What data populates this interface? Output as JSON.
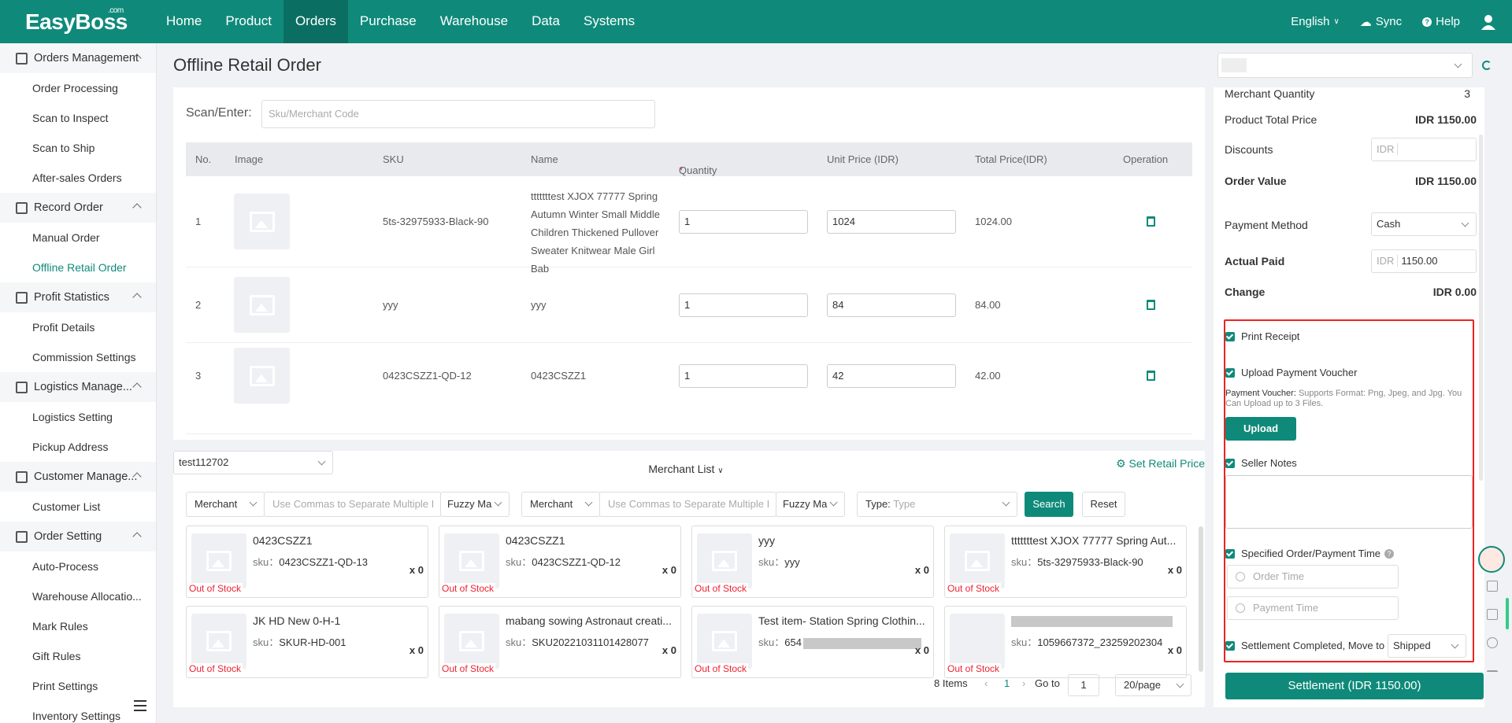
{
  "brand": {
    "name": "EasyBoss",
    "sup": ".com"
  },
  "nav": [
    {
      "label": "Home"
    },
    {
      "label": "Product"
    },
    {
      "label": "Orders",
      "active": true
    },
    {
      "label": "Purchase"
    },
    {
      "label": "Warehouse"
    },
    {
      "label": "Data"
    },
    {
      "label": "Systems"
    }
  ],
  "topright": {
    "language": "English",
    "sync": "Sync",
    "help": "Help"
  },
  "sidebar": {
    "groups": [
      {
        "label": "Orders Management",
        "items": [
          "Order Processing",
          "Scan to Inspect",
          "Scan to Ship",
          "After-sales Orders"
        ]
      },
      {
        "label": "Record Order",
        "items": [
          "Manual Order",
          "Offline Retail Order"
        ]
      },
      {
        "label": "Profit Statistics",
        "items": [
          "Profit Details",
          "Commission Settings"
        ]
      },
      {
        "label": "Logistics Manage...",
        "items": [
          "Logistics Setting",
          "Pickup Address"
        ]
      },
      {
        "label": "Customer Manage...",
        "items": [
          "Customer List"
        ]
      },
      {
        "label": "Order Setting",
        "items": [
          "Auto-Process",
          "Warehouse Allocatio...",
          "Mark Rules",
          "Gift Rules",
          "Print Settings",
          "Inventory Settings"
        ]
      }
    ],
    "active_item": "Offline Retail Order"
  },
  "page": {
    "title": "Offline Retail Order"
  },
  "scan": {
    "label": "Scan/Enter:",
    "placeholder": "Sku/Merchant Code"
  },
  "table": {
    "headers": {
      "no": "No.",
      "image": "Image",
      "sku": "SKU",
      "name": "Name",
      "quantity_mark": "*",
      "quantity": "Quantity",
      "unit_price": "Unit Price (IDR)",
      "total": "Total Price(IDR)",
      "operation": "Operation"
    },
    "rows": [
      {
        "no": "1",
        "sku": "5ts-32975933-Black-90",
        "name": "tttttttest XJOX 77777 Spring Autumn Winter Small Middle Children Thickened Pullover Sweater Knitwear Male Girl Bab",
        "qty": "1",
        "unit": "1024",
        "total": "1024.00"
      },
      {
        "no": "2",
        "sku": "yyy",
        "name": "yyy",
        "qty": "1",
        "unit": "84",
        "total": "84.00"
      },
      {
        "no": "3",
        "sku": "0423CSZZ1-QD-12",
        "name": "0423CSZZ1",
        "qty": "1",
        "unit": "42",
        "total": "42.00"
      }
    ]
  },
  "merchants": {
    "store": "test112702",
    "list_tab": "Merchant List",
    "set_price": "Set Retail Price",
    "filter": {
      "field1": "Merchant",
      "ph1": "Use Commas to Separate Multiple I",
      "match1": "Fuzzy Ma",
      "field2": "Merchant",
      "ph2": "Use Commas to Separate Multiple I",
      "match2": "Fuzzy Ma",
      "type_label": "Type:",
      "type_ph": "Type",
      "search": "Search",
      "reset": "Reset"
    },
    "cards": [
      {
        "name": "0423CSZZ1",
        "sku_label": "sku：",
        "sku": "0423CSZZ1-QD-13",
        "count": "x 0",
        "status": "Out of Stock"
      },
      {
        "name": "0423CSZZ1",
        "sku_label": "sku：",
        "sku": "0423CSZZ1-QD-12",
        "count": "x 0",
        "status": "Out of Stock"
      },
      {
        "name": "yyy",
        "sku_label": "sku：",
        "sku": "yyy",
        "count": "x 0",
        "status": "Out of Stock"
      },
      {
        "name": "tttttttest XJOX 77777 Spring Aut...",
        "sku_label": "sku：",
        "sku": "5ts-32975933-Black-90",
        "count": "x 0",
        "status": "Out of Stock"
      },
      {
        "name": "JK HD New 0-H-1",
        "sku_label": "sku：",
        "sku": "SKUR-HD-001",
        "count": "x 0",
        "status": "Out of Stock"
      },
      {
        "name": "mabang sowing Astronaut creati...",
        "sku_label": "sku：",
        "sku": "SKU20221031101428077",
        "count": "x 0",
        "status": "Out of Stock"
      },
      {
        "name": "Test item- Station Spring Clothin...",
        "sku_label": "sku：",
        "sku": "654",
        "count": "x 0",
        "status": "Out of Stock"
      },
      {
        "name": "",
        "sku_label": "sku：",
        "sku": "1059667372_23259202304",
        "count": "x 0",
        "status": "Out of Stock"
      }
    ],
    "pagination": {
      "total": "8 Items",
      "page": "1",
      "goto": "Go to",
      "goto_val": "1",
      "per_page": "20/page"
    }
  },
  "summary": {
    "merchant_qty_label": "Merchant Quantity",
    "merchant_qty": "3",
    "product_total_label": "Product Total Price",
    "product_total": "IDR 1150.00",
    "discounts_label": "Discounts",
    "currency": "IDR",
    "order_value_label": "Order Value",
    "order_value": "IDR 1150.00",
    "payment_method_label": "Payment Method",
    "payment_method": "Cash",
    "actual_paid_label": "Actual Paid",
    "actual_paid": "1150.00",
    "change_label": "Change",
    "change": "IDR 0.00"
  },
  "options": {
    "print_receipt": "Print Receipt",
    "upload_voucher": "Upload Payment Voucher",
    "voucher_label": "Payment Voucher:",
    "voucher_hint": "Supports Format: Png, Jpeg, and Jpg. You Can Upload up to 3 Files.",
    "upload_btn": "Upload",
    "seller_notes": "Seller Notes",
    "specified_time": "Specified Order/Payment Time",
    "order_time_ph": "Order Time",
    "payment_time_ph": "Payment Time",
    "settlement_move": "Settlement Completed, Move to",
    "shipped": "Shipped"
  },
  "settle_btn": "Settlement (IDR 1150.00)",
  "colors": {
    "brand": "#0f8a7a",
    "danger": "#e22222"
  }
}
